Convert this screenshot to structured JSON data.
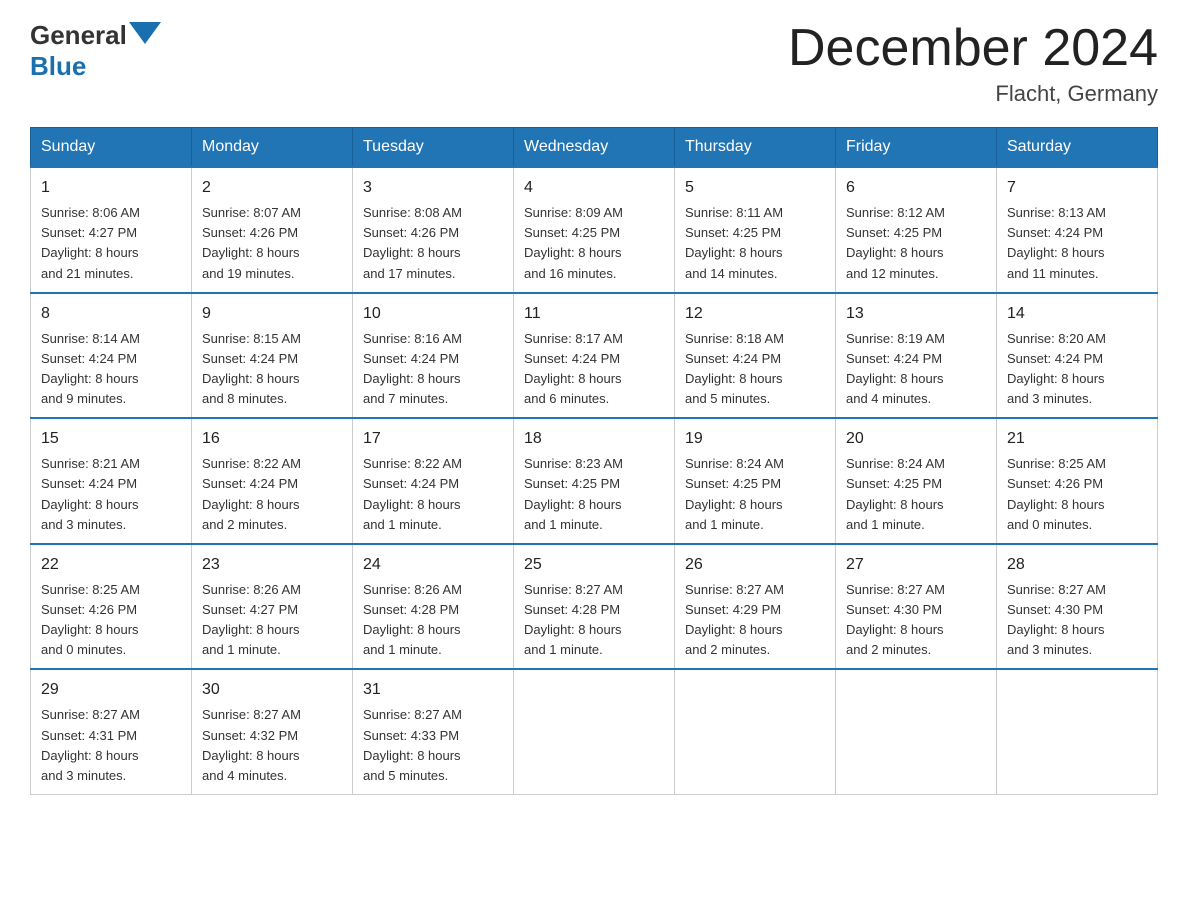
{
  "header": {
    "logo_general": "General",
    "logo_blue": "Blue",
    "month_title": "December 2024",
    "location": "Flacht, Germany"
  },
  "days_of_week": [
    "Sunday",
    "Monday",
    "Tuesday",
    "Wednesday",
    "Thursday",
    "Friday",
    "Saturday"
  ],
  "weeks": [
    [
      {
        "day": "1",
        "sunrise": "8:06 AM",
        "sunset": "4:27 PM",
        "daylight": "8 hours and 21 minutes."
      },
      {
        "day": "2",
        "sunrise": "8:07 AM",
        "sunset": "4:26 PM",
        "daylight": "8 hours and 19 minutes."
      },
      {
        "day": "3",
        "sunrise": "8:08 AM",
        "sunset": "4:26 PM",
        "daylight": "8 hours and 17 minutes."
      },
      {
        "day": "4",
        "sunrise": "8:09 AM",
        "sunset": "4:25 PM",
        "daylight": "8 hours and 16 minutes."
      },
      {
        "day": "5",
        "sunrise": "8:11 AM",
        "sunset": "4:25 PM",
        "daylight": "8 hours and 14 minutes."
      },
      {
        "day": "6",
        "sunrise": "8:12 AM",
        "sunset": "4:25 PM",
        "daylight": "8 hours and 12 minutes."
      },
      {
        "day": "7",
        "sunrise": "8:13 AM",
        "sunset": "4:24 PM",
        "daylight": "8 hours and 11 minutes."
      }
    ],
    [
      {
        "day": "8",
        "sunrise": "8:14 AM",
        "sunset": "4:24 PM",
        "daylight": "8 hours and 9 minutes."
      },
      {
        "day": "9",
        "sunrise": "8:15 AM",
        "sunset": "4:24 PM",
        "daylight": "8 hours and 8 minutes."
      },
      {
        "day": "10",
        "sunrise": "8:16 AM",
        "sunset": "4:24 PM",
        "daylight": "8 hours and 7 minutes."
      },
      {
        "day": "11",
        "sunrise": "8:17 AM",
        "sunset": "4:24 PM",
        "daylight": "8 hours and 6 minutes."
      },
      {
        "day": "12",
        "sunrise": "8:18 AM",
        "sunset": "4:24 PM",
        "daylight": "8 hours and 5 minutes."
      },
      {
        "day": "13",
        "sunrise": "8:19 AM",
        "sunset": "4:24 PM",
        "daylight": "8 hours and 4 minutes."
      },
      {
        "day": "14",
        "sunrise": "8:20 AM",
        "sunset": "4:24 PM",
        "daylight": "8 hours and 3 minutes."
      }
    ],
    [
      {
        "day": "15",
        "sunrise": "8:21 AM",
        "sunset": "4:24 PM",
        "daylight": "8 hours and 3 minutes."
      },
      {
        "day": "16",
        "sunrise": "8:22 AM",
        "sunset": "4:24 PM",
        "daylight": "8 hours and 2 minutes."
      },
      {
        "day": "17",
        "sunrise": "8:22 AM",
        "sunset": "4:24 PM",
        "daylight": "8 hours and 1 minute."
      },
      {
        "day": "18",
        "sunrise": "8:23 AM",
        "sunset": "4:25 PM",
        "daylight": "8 hours and 1 minute."
      },
      {
        "day": "19",
        "sunrise": "8:24 AM",
        "sunset": "4:25 PM",
        "daylight": "8 hours and 1 minute."
      },
      {
        "day": "20",
        "sunrise": "8:24 AM",
        "sunset": "4:25 PM",
        "daylight": "8 hours and 1 minute."
      },
      {
        "day": "21",
        "sunrise": "8:25 AM",
        "sunset": "4:26 PM",
        "daylight": "8 hours and 0 minutes."
      }
    ],
    [
      {
        "day": "22",
        "sunrise": "8:25 AM",
        "sunset": "4:26 PM",
        "daylight": "8 hours and 0 minutes."
      },
      {
        "day": "23",
        "sunrise": "8:26 AM",
        "sunset": "4:27 PM",
        "daylight": "8 hours and 1 minute."
      },
      {
        "day": "24",
        "sunrise": "8:26 AM",
        "sunset": "4:28 PM",
        "daylight": "8 hours and 1 minute."
      },
      {
        "day": "25",
        "sunrise": "8:27 AM",
        "sunset": "4:28 PM",
        "daylight": "8 hours and 1 minute."
      },
      {
        "day": "26",
        "sunrise": "8:27 AM",
        "sunset": "4:29 PM",
        "daylight": "8 hours and 2 minutes."
      },
      {
        "day": "27",
        "sunrise": "8:27 AM",
        "sunset": "4:30 PM",
        "daylight": "8 hours and 2 minutes."
      },
      {
        "day": "28",
        "sunrise": "8:27 AM",
        "sunset": "4:30 PM",
        "daylight": "8 hours and 3 minutes."
      }
    ],
    [
      {
        "day": "29",
        "sunrise": "8:27 AM",
        "sunset": "4:31 PM",
        "daylight": "8 hours and 3 minutes."
      },
      {
        "day": "30",
        "sunrise": "8:27 AM",
        "sunset": "4:32 PM",
        "daylight": "8 hours and 4 minutes."
      },
      {
        "day": "31",
        "sunrise": "8:27 AM",
        "sunset": "4:33 PM",
        "daylight": "8 hours and 5 minutes."
      },
      null,
      null,
      null,
      null
    ]
  ],
  "labels": {
    "sunrise": "Sunrise:",
    "sunset": "Sunset:",
    "daylight": "Daylight:"
  }
}
